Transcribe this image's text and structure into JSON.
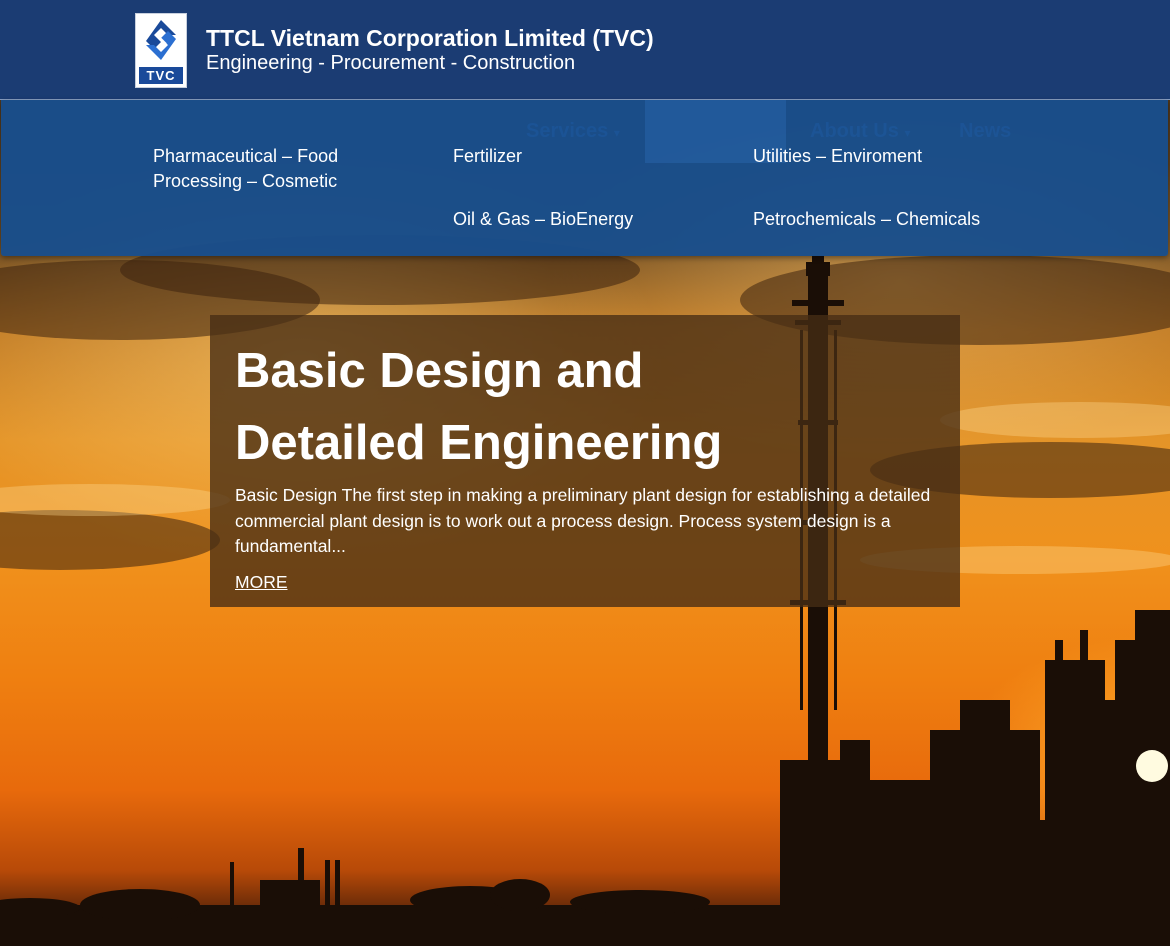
{
  "brand": {
    "logo_text": "TVC",
    "title": "TTCL Vietnam Corporation Limited (TVC)",
    "subtitle": "Engineering - Procurement - Construction"
  },
  "nav": {
    "services": "Services",
    "about": "About Us",
    "news": "News"
  },
  "mega_menu": {
    "items": [
      "Pharmaceutical – Food Processing – Cosmetic",
      "Fertilizer",
      "Utilities – Enviroment",
      "Oil & Gas – BioEnergy",
      "Petrochemicals – Chemicals"
    ]
  },
  "slide": {
    "title": "Basic Design and Detailed Engineering",
    "text": "Basic Design The first step in making a preliminary plant design for establishing a detailed commercial plant design is to work out a process design. Process system design is a fundamental...",
    "more": "MORE"
  },
  "colors": {
    "header_bg": "#1b3c73",
    "menu_bg": "#184e8c",
    "caption_bg": "#462d14"
  },
  "icons": [
    "tvc-logo-icon",
    "chevron-down-icon"
  ]
}
